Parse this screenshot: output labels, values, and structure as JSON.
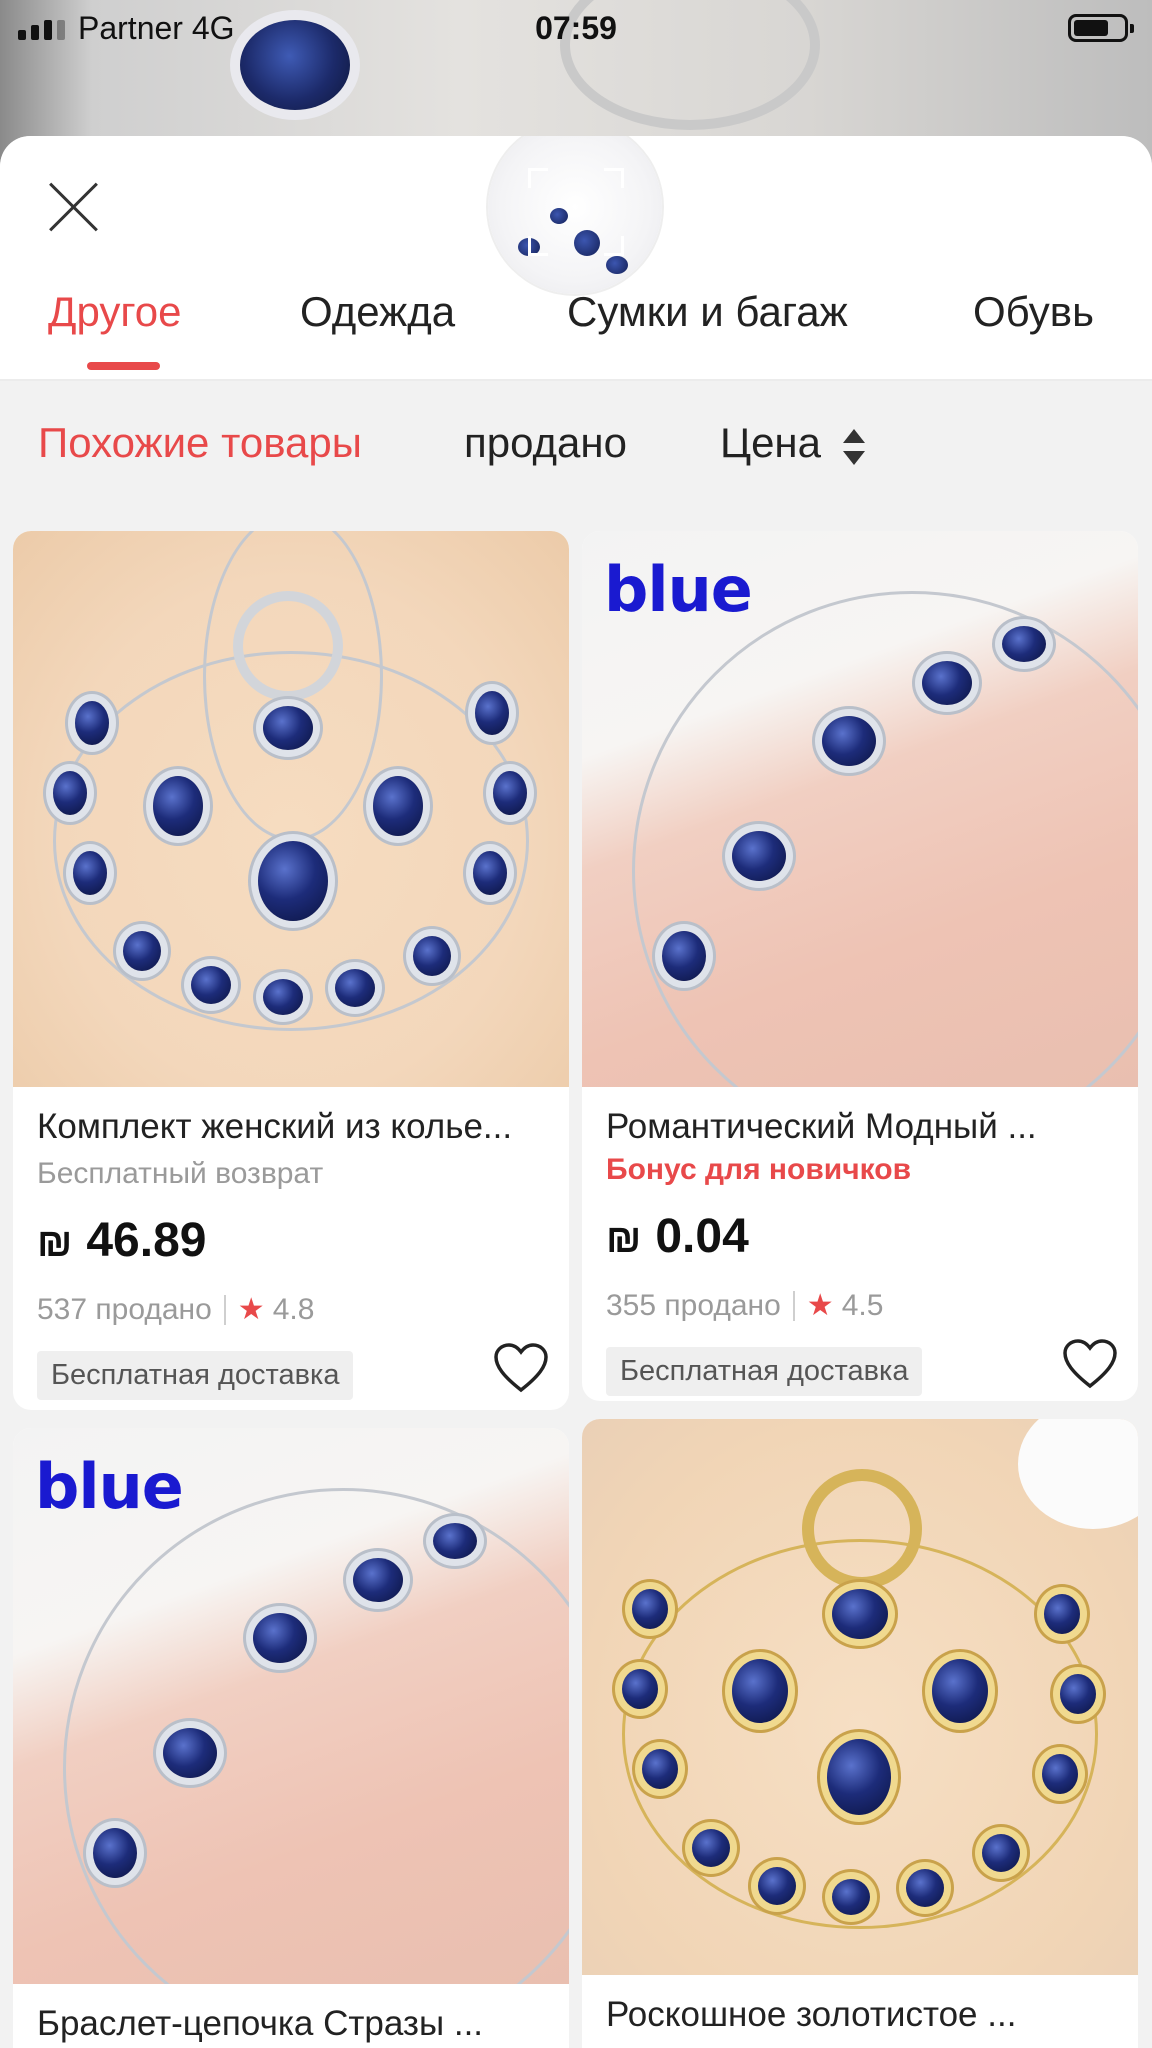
{
  "status_bar": {
    "carrier": "Partner  4G",
    "time": "07:59"
  },
  "tabs": [
    {
      "label": "Другое",
      "active": true
    },
    {
      "label": "Одежда",
      "active": false
    },
    {
      "label": "Сумки и багаж",
      "active": false
    },
    {
      "label": "Обувь",
      "active": false
    }
  ],
  "sort": [
    {
      "label": "Похожие товары",
      "active": true
    },
    {
      "label": "продано",
      "active": false
    },
    {
      "label": "Цена",
      "active": false
    }
  ],
  "products": [
    {
      "title": "Комплект женский из колье...",
      "subtitle": "Бесплатный возврат",
      "currency": "₪",
      "price": "46.89",
      "sold": "537 продано",
      "rating": "4.8",
      "shipping": "Бесплатная доставка"
    },
    {
      "title": "Романтический Модный ...",
      "subtitle": "Бонус для новичков",
      "currency": "₪",
      "price": "0.04",
      "sold": "355 продано",
      "rating": "4.5",
      "shipping": "Бесплатная доставка",
      "image_label": "blue"
    },
    {
      "title": "Браслет-цепочка Стразы ...",
      "image_label": "blue"
    },
    {
      "title": "Роскошное золотистое ..."
    }
  ],
  "colors": {
    "accent": "#e8494a",
    "sapphire": "#1d2c7a",
    "label_blue": "#1a1ad0"
  },
  "icons": [
    "signal-icon",
    "battery-icon",
    "close-icon",
    "sort-arrows-icon",
    "star-icon",
    "heart-icon"
  ]
}
